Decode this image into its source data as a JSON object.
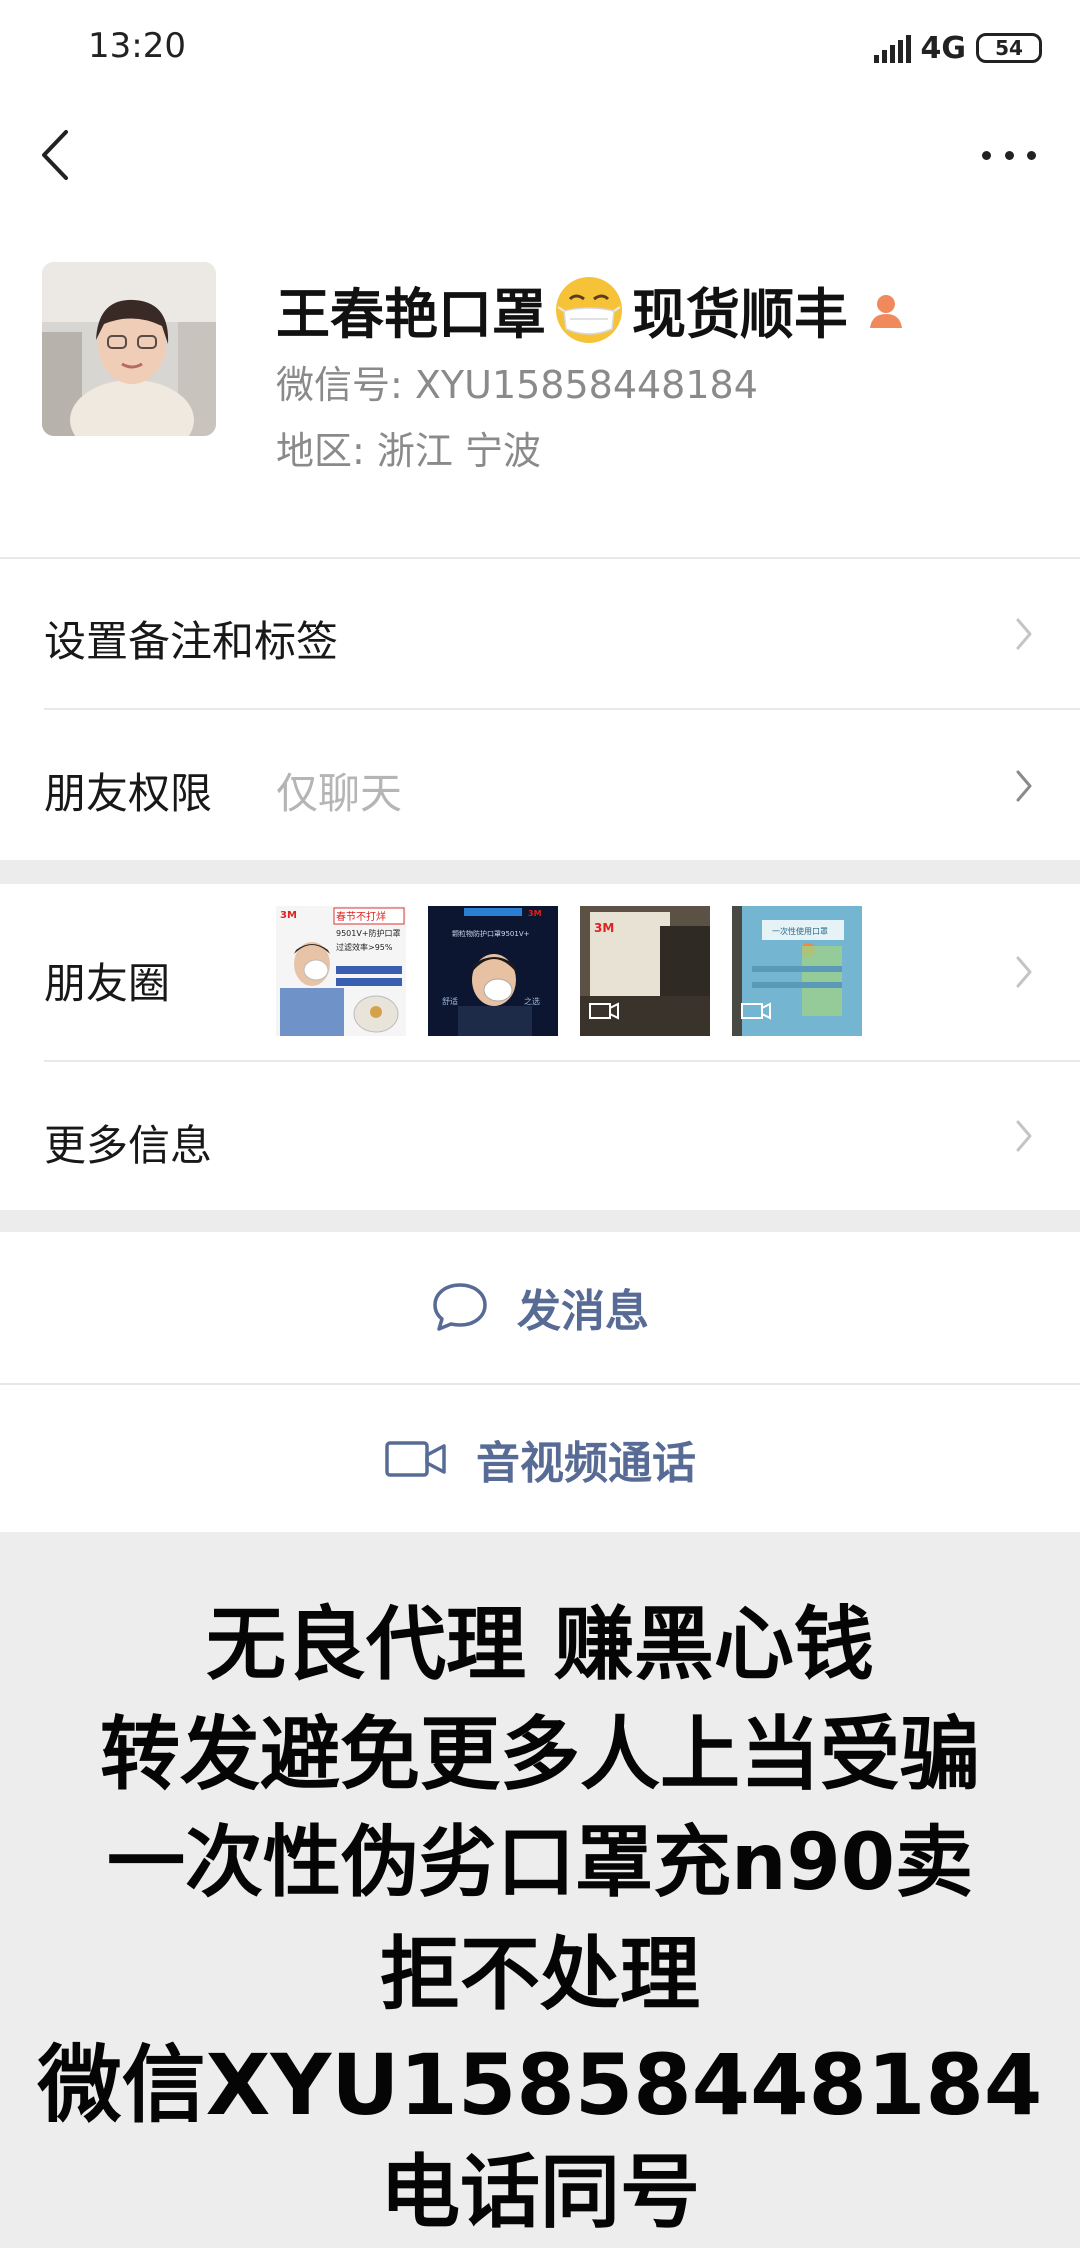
{
  "status_bar": {
    "time": "13:20",
    "network": "4G",
    "battery": "54"
  },
  "profile": {
    "name": "王春艳口罩",
    "name_suffix": "现货顺丰",
    "wechat_id": "微信号:  XYU15858448184",
    "region": "地区:  浙江  宁波",
    "icons": {
      "emoji": "mask-face-emoji",
      "badge": "person-icon"
    }
  },
  "menu": {
    "remark_label": "设置备注和标签",
    "permission_label": "朋友权限",
    "permission_value": "仅聊天",
    "moments_label": "朋友圈",
    "more_info_label": "更多信息"
  },
  "moments_thumbs": [
    {
      "name": "moments-thumb-mask-ad-1",
      "lines": [
        "春节不打烊",
        "9501V+防护口罩",
        "过滤效率>95%"
      ]
    },
    {
      "name": "moments-thumb-mask-ad-2",
      "lines": [
        "颗粒物防护口罩9501V+",
        "舒适",
        "之选"
      ]
    },
    {
      "name": "moments-thumb-video-1",
      "lines": []
    },
    {
      "name": "moments-thumb-video-2",
      "lines": [
        "一次性使用口罩"
      ]
    }
  ],
  "actions": {
    "message": "发消息",
    "call": "音视频通话"
  },
  "warning": {
    "line1": "无良代理 赚黑心钱",
    "line2": "转发避免更多人上当受骗",
    "line3": "一次性伪劣口罩充n90卖",
    "line4": "拒不处理",
    "line5": "微信XYU15858448184",
    "line6": "电话同号"
  },
  "colors": {
    "link": "#576b95",
    "accent_badge": "#f08a5d",
    "background_gap": "#ececec"
  }
}
